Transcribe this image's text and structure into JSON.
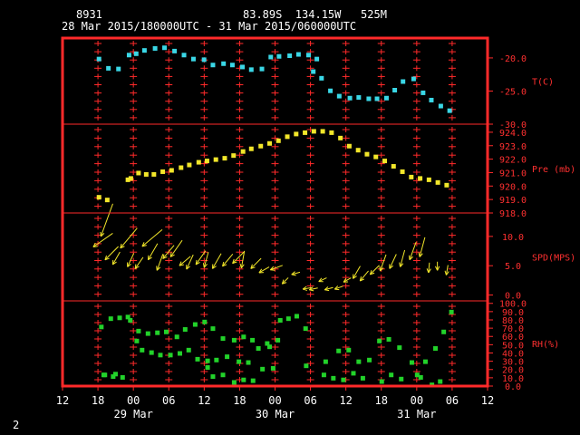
{
  "header": {
    "station": "8931",
    "location": "83.89S  134.15W   525M",
    "time_range": "28 Mar 2015/180000UTC - 31 Mar 2015/060000UTC"
  },
  "footer": {
    "page_number": "2"
  },
  "colors": {
    "frame": "#ff2a2a",
    "tick_label": "#ff3030",
    "temperature": "#3ad7e6",
    "pressure": "#f2e62a",
    "wind": "#f2e62a",
    "humidity": "#22d22a",
    "text": "#ffffff"
  },
  "chart_data": {
    "type": "scatter",
    "x_axis": {
      "unit": "hours since 28 Mar 2015 12 UTC",
      "range": [
        0,
        72
      ],
      "tick_labels": [
        "12",
        "18",
        "00",
        "06",
        "12",
        "18",
        "00",
        "06",
        "12",
        "18",
        "00",
        "06",
        "12"
      ],
      "date_labels": [
        {
          "hour": 12,
          "label": "29 Mar"
        },
        {
          "hour": 36,
          "label": "30 Mar"
        },
        {
          "hour": 60,
          "label": "31 Mar"
        }
      ]
    },
    "panels": [
      {
        "name": "temperature",
        "ylabel": "T(C)",
        "ylim": [
          -30,
          -17
        ],
        "ticks": [
          "-20.0",
          "-25.0",
          "-30.0"
        ],
        "tick_values": [
          -20,
          -25,
          -30
        ],
        "points": [
          [
            6.1,
            -20.1
          ],
          [
            7.7,
            -21.5
          ],
          [
            9.4,
            -21.6
          ],
          [
            11.2,
            -19.5
          ],
          [
            12.4,
            -19.3
          ],
          [
            13.8,
            -18.8
          ],
          [
            15.6,
            -18.5
          ],
          [
            17.2,
            -18.4
          ],
          [
            18.9,
            -18.9
          ],
          [
            20.5,
            -19.5
          ],
          [
            22.1,
            -20.1
          ],
          [
            23.9,
            -20.2
          ],
          [
            25.4,
            -21.0
          ],
          [
            27.2,
            -20.8
          ],
          [
            28.7,
            -21.0
          ],
          [
            30.4,
            -21.3
          ],
          [
            31.9,
            -21.7
          ],
          [
            33.7,
            -21.6
          ],
          [
            35.2,
            -19.8
          ],
          [
            36.6,
            -19.7
          ],
          [
            38.4,
            -19.6
          ],
          [
            39.9,
            -19.4
          ],
          [
            41.6,
            -19.5
          ],
          [
            43.0,
            -20.1
          ],
          [
            42.4,
            -22.0
          ],
          [
            43.8,
            -23.0
          ],
          [
            45.3,
            -24.9
          ],
          [
            46.8,
            -25.7
          ],
          [
            48.6,
            -26.0
          ],
          [
            50.1,
            -25.9
          ],
          [
            51.8,
            -26.1
          ],
          [
            53.2,
            -26.1
          ],
          [
            54.8,
            -26.0
          ],
          [
            56.2,
            -24.8
          ],
          [
            57.6,
            -23.5
          ],
          [
            59.4,
            -23.1
          ],
          [
            61.0,
            -25.2
          ],
          [
            62.4,
            -26.3
          ],
          [
            64.0,
            -27.2
          ],
          [
            65.5,
            -27.9
          ]
        ]
      },
      {
        "name": "pressure",
        "ylabel": "Pre (mb)",
        "ylim": [
          918,
          924.6
        ],
        "ticks": [
          "924.0",
          "923.0",
          "922.0",
          "921.0",
          "920.0",
          "919.0",
          "918.0"
        ],
        "tick_values": [
          924,
          923,
          922,
          921,
          920,
          919,
          918
        ],
        "points": [
          [
            6.1,
            919.2
          ],
          [
            7.5,
            919.0
          ],
          [
            11.0,
            920.5
          ],
          [
            11.5,
            920.6
          ],
          [
            12.8,
            921.0
          ],
          [
            14.1,
            920.9
          ],
          [
            15.4,
            920.9
          ],
          [
            16.9,
            921.1
          ],
          [
            18.4,
            921.2
          ],
          [
            20.0,
            921.4
          ],
          [
            21.4,
            921.6
          ],
          [
            23.0,
            921.8
          ],
          [
            24.4,
            921.9
          ],
          [
            25.9,
            922.0
          ],
          [
            27.4,
            922.1
          ],
          [
            28.9,
            922.3
          ],
          [
            30.5,
            922.6
          ],
          [
            31.9,
            922.8
          ],
          [
            33.5,
            923.0
          ],
          [
            35.0,
            923.2
          ],
          [
            36.5,
            923.4
          ],
          [
            38.0,
            923.7
          ],
          [
            39.5,
            923.9
          ],
          [
            41.0,
            924.0
          ],
          [
            42.5,
            924.1
          ],
          [
            44.0,
            924.1
          ],
          [
            45.5,
            924.0
          ],
          [
            47.0,
            923.6
          ],
          [
            48.5,
            923.0
          ],
          [
            50.0,
            922.7
          ],
          [
            51.5,
            922.4
          ],
          [
            53.0,
            922.2
          ],
          [
            54.5,
            921.9
          ],
          [
            56.0,
            921.5
          ],
          [
            57.5,
            921.1
          ],
          [
            59.0,
            920.7
          ],
          [
            60.5,
            920.6
          ],
          [
            62.0,
            920.5
          ],
          [
            63.5,
            920.3
          ],
          [
            65.0,
            920.1
          ]
        ]
      },
      {
        "name": "wind",
        "ylabel": "SPD(MPS)",
        "ylim": [
          -1,
          14
        ],
        "ticks": [
          "10.0",
          "5.0",
          "0.0"
        ],
        "tick_values": [
          10,
          5,
          0
        ],
        "arrows": [
          [
            5.2,
            8.2,
            35,
            8.2
          ],
          [
            6.5,
            10.0,
            70,
            12.0
          ],
          [
            7.2,
            6.0,
            45,
            6.5
          ],
          [
            8.5,
            5.2,
            60,
            5.0
          ],
          [
            9.8,
            8.0,
            50,
            9.0
          ],
          [
            11.0,
            4.8,
            65,
            5.2
          ],
          [
            12.3,
            4.5,
            55,
            4.8
          ],
          [
            13.5,
            8.3,
            40,
            9.0
          ],
          [
            14.5,
            6.0,
            60,
            6.5
          ],
          [
            16.0,
            4.2,
            70,
            6.0
          ],
          [
            17.0,
            6.2,
            50,
            6.0
          ],
          [
            18.3,
            6.5,
            55,
            7.0
          ],
          [
            19.8,
            5.0,
            40,
            5.0
          ],
          [
            21.0,
            4.4,
            65,
            5.5
          ],
          [
            22.6,
            5.2,
            55,
            5.8
          ],
          [
            24.0,
            4.7,
            75,
            5.5
          ],
          [
            25.4,
            4.5,
            60,
            6.0
          ],
          [
            27.1,
            4.9,
            50,
            5.5
          ],
          [
            28.8,
            5.4,
            45,
            5.8
          ],
          [
            30.3,
            4.6,
            80,
            6.0
          ],
          [
            31.9,
            4.5,
            45,
            5.0
          ],
          [
            33.3,
            3.8,
            30,
            4.0
          ],
          [
            35.2,
            4.3,
            20,
            4.5
          ],
          [
            37.2,
            1.9,
            45,
            3.0
          ],
          [
            38.8,
            3.5,
            15,
            3.0
          ],
          [
            40.7,
            1.0,
            10,
            3.0
          ],
          [
            41.8,
            0.9,
            12,
            3.0
          ],
          [
            43.4,
            2.3,
            25,
            3.0
          ],
          [
            44.4,
            0.9,
            15,
            3.0
          ],
          [
            46.1,
            1.0,
            20,
            3.0
          ],
          [
            47.6,
            2.2,
            30,
            3.0
          ],
          [
            49.2,
            2.8,
            60,
            5.0
          ],
          [
            50.4,
            2.4,
            50,
            4.5
          ],
          [
            52.1,
            3.5,
            45,
            4.5
          ],
          [
            53.8,
            4.1,
            70,
            6.0
          ],
          [
            55.4,
            4.5,
            65,
            5.5
          ],
          [
            57.2,
            4.8,
            75,
            6.0
          ],
          [
            58.8,
            6.0,
            70,
            6.5
          ],
          [
            60.5,
            6.5,
            75,
            7.0
          ],
          [
            62.0,
            3.8,
            85,
            3.5
          ],
          [
            63.5,
            4.2,
            90,
            3.0
          ],
          [
            65.0,
            3.4,
            80,
            3.5
          ]
        ]
      },
      {
        "name": "humidity",
        "ylabel": "RH(%)",
        "ylim": [
          0,
          103
        ],
        "ticks": [
          "100.0",
          "90.0",
          "80.0",
          "70.0",
          "60.0",
          "50.0",
          "40.0",
          "30.0",
          "20.0",
          "10.0",
          "0.0"
        ],
        "tick_values": [
          100,
          90,
          80,
          70,
          60,
          50,
          40,
          30,
          20,
          10,
          0
        ],
        "points": [
          [
            6.5,
            72
          ],
          [
            8.1,
            82
          ],
          [
            9.6,
            83
          ],
          [
            11.0,
            84
          ],
          [
            11.4,
            80
          ],
          [
            12.8,
            67
          ],
          [
            14.4,
            64
          ],
          [
            16.0,
            65
          ],
          [
            17.5,
            66
          ],
          [
            19.3,
            60
          ],
          [
            20.7,
            69
          ],
          [
            22.4,
            75
          ],
          [
            24.0,
            78
          ],
          [
            25.4,
            70
          ],
          [
            27.1,
            58
          ],
          [
            29.0,
            56
          ],
          [
            30.6,
            60
          ],
          [
            32.1,
            56
          ],
          [
            35.0,
            48
          ],
          [
            36.8,
            80
          ],
          [
            38.2,
            82
          ],
          [
            39.6,
            85
          ],
          [
            41.1,
            70
          ],
          [
            12.5,
            55
          ],
          [
            13.4,
            44
          ],
          [
            15.0,
            41
          ],
          [
            16.5,
            38
          ],
          [
            18.2,
            38
          ],
          [
            19.8,
            40
          ],
          [
            21.3,
            44
          ],
          [
            22.8,
            33
          ],
          [
            24.5,
            31
          ],
          [
            26.0,
            32
          ],
          [
            27.8,
            36
          ],
          [
            29.8,
            30
          ],
          [
            31.4,
            29
          ],
          [
            33.1,
            46
          ],
          [
            34.6,
            52
          ],
          [
            36.4,
            56
          ],
          [
            44.5,
            30
          ],
          [
            46.7,
            43
          ],
          [
            48.4,
            44
          ],
          [
            50.1,
            30
          ],
          [
            51.9,
            32
          ],
          [
            53.6,
            55
          ],
          [
            55.2,
            57
          ],
          [
            57.0,
            47
          ],
          [
            59.1,
            29
          ],
          [
            61.4,
            30
          ],
          [
            63.1,
            46
          ],
          [
            64.5,
            66
          ],
          [
            65.8,
            90
          ],
          [
            6.9,
            14
          ],
          [
            8.5,
            12
          ],
          [
            10.1,
            11
          ],
          [
            24.5,
            23
          ],
          [
            25.4,
            12
          ],
          [
            27.1,
            14
          ],
          [
            29.0,
            5
          ],
          [
            30.6,
            8
          ],
          [
            32.2,
            7
          ],
          [
            33.8,
            21
          ],
          [
            35.6,
            22
          ],
          [
            41.2,
            25
          ],
          [
            44.2,
            14
          ],
          [
            45.8,
            10
          ],
          [
            47.5,
            8
          ],
          [
            49.2,
            16
          ],
          [
            50.8,
            10
          ],
          [
            54.0,
            6
          ],
          [
            55.6,
            14
          ],
          [
            57.3,
            9
          ],
          [
            60.0,
            14
          ],
          [
            60.6,
            11
          ],
          [
            62.5,
            2
          ],
          [
            63.9,
            6
          ],
          [
            7.1,
            14
          ],
          [
            8.9,
            15
          ]
        ]
      }
    ]
  }
}
